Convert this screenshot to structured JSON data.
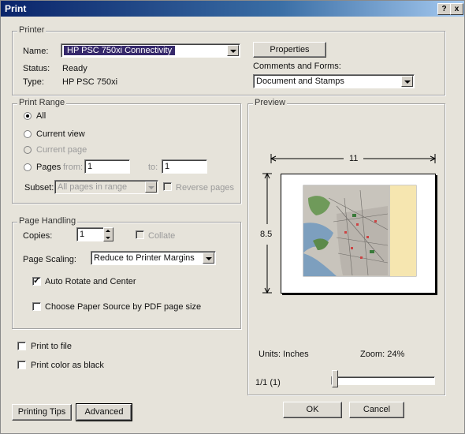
{
  "window": {
    "title": "Print",
    "help_btn": "?",
    "close_btn": "x"
  },
  "printer": {
    "legend": "Printer",
    "name_label": "Name:",
    "name_value": "HP PSC 750xi Connectivity",
    "status_label": "Status:",
    "status_value": "Ready",
    "type_label": "Type:",
    "type_value": "HP PSC 750xi",
    "properties_btn": "Properties",
    "comments_label": "Comments and Forms:",
    "comments_value": "Document and Stamps"
  },
  "print_range": {
    "legend": "Print Range",
    "all": "All",
    "current_view": "Current view",
    "current_page": "Current page",
    "pages": "Pages",
    "from_label": "from:",
    "from_value": "1",
    "to_label": "to:",
    "to_value": "1",
    "subset_label": "Subset:",
    "subset_value": "All pages in range",
    "reverse_label": "Reverse pages"
  },
  "page_handling": {
    "legend": "Page Handling",
    "copies_label": "Copies:",
    "copies_value": "1",
    "collate_label": "Collate",
    "scaling_label": "Page Scaling:",
    "scaling_value": "Reduce to Printer Margins",
    "auto_rotate": "Auto Rotate and Center",
    "choose_source": "Choose Paper Source by PDF page size"
  },
  "options": {
    "print_to_file": "Print to file",
    "print_black": "Print color as black"
  },
  "preview": {
    "legend": "Preview",
    "width": "11",
    "height": "8.5",
    "units": "Units: Inches",
    "zoom": "Zoom:  24%",
    "page_indicator": "1/1 (1)",
    "slider_level": 0
  },
  "buttons": {
    "tips": "Printing Tips",
    "advanced": "Advanced",
    "ok": "OK",
    "cancel": "Cancel"
  }
}
